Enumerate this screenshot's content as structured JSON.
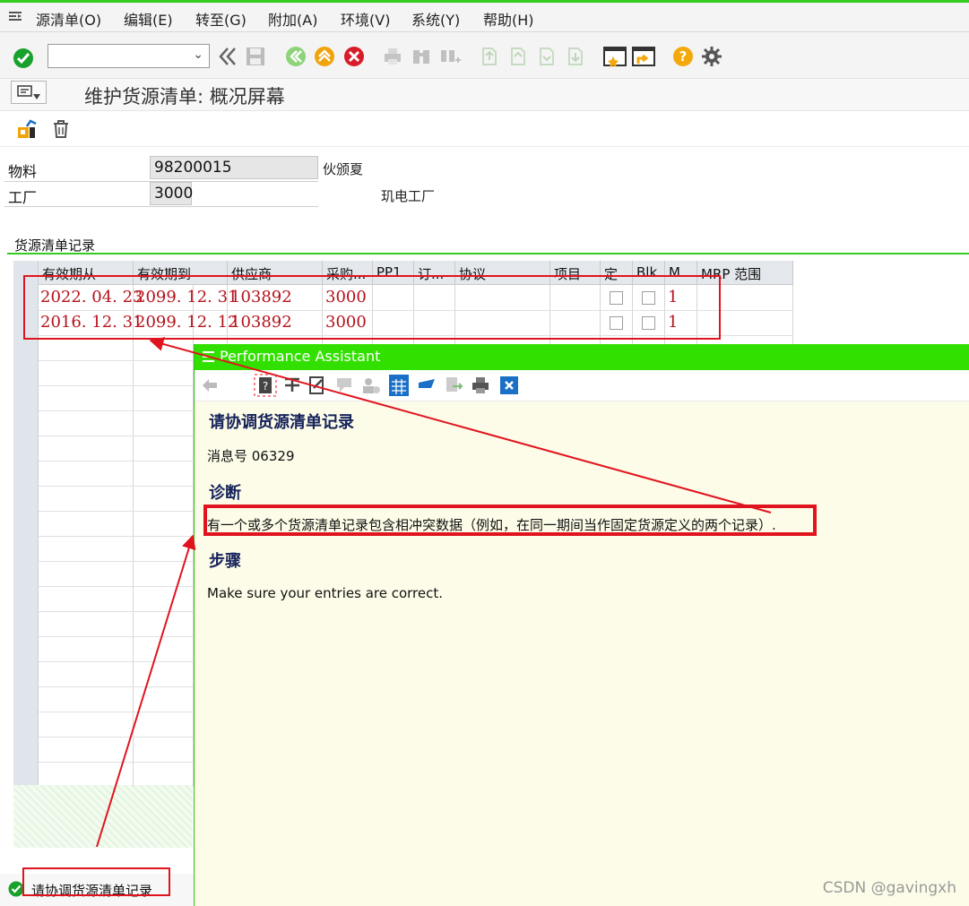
{
  "menu": [
    "源清单(O)",
    "编辑(E)",
    "转至(G)",
    "附加(A)",
    "环境(V)",
    "系统(Y)",
    "帮助(H)"
  ],
  "page": {
    "title": "维护货源清单: 概况屏幕"
  },
  "header": {
    "material_label": "物料",
    "material_value": "98200015",
    "material_desc": "伙颁夏",
    "plant_label": "工厂",
    "plant_value": "3000",
    "plant_desc": "玑电工厂"
  },
  "section": {
    "title": "货源清单记录"
  },
  "table": {
    "columns": [
      "有效期从",
      "有效期到",
      "供应商",
      "采购...",
      "PP1",
      "订...",
      "协议",
      "项目",
      "定",
      "Blk",
      "M...",
      "MRP 范围"
    ],
    "rows": [
      {
        "from": "2022. 04. 23",
        "to": "2099. 12. 31",
        "vendor": "103892",
        "porg": "3000",
        "fixed": false,
        "blk": false,
        "mrp": "1"
      },
      {
        "from": "2016. 12. 31",
        "to": "2099. 12. 12",
        "vendor": "103892",
        "porg": "3000",
        "fixed": false,
        "blk": false,
        "mrp": "1"
      }
    ]
  },
  "assistant": {
    "window_title": "Performance Assistant",
    "heading": "请协调货源清单记录",
    "message_no": "消息号 06329",
    "diag_heading": "诊断",
    "diag_text": "有一个或多个货源清单记录包含相冲突数据（例如，在同一期间当作固定货源定义的两个记录）.",
    "steps_heading": "步骤",
    "steps_text": "Make sure your entries are correct."
  },
  "status": {
    "text": "请协调货源清单记录"
  },
  "watermark": "CSDN @gavingxh",
  "colors": {
    "accent": "#32cd1e",
    "annotation": "#e0141e",
    "data_text": "#b5121b",
    "help_heading": "#16235a"
  }
}
